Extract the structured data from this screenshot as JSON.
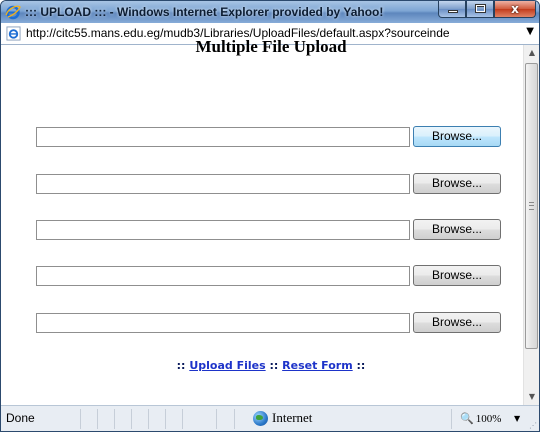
{
  "window": {
    "title": "::: UPLOAD ::: - Windows Internet Explorer provided by Yahoo!",
    "icon": "ie-icon",
    "controls": {
      "minimize": "minimize-icon",
      "maximize": "maximize-icon",
      "close": "x"
    }
  },
  "address": {
    "url": "http://citc55.mans.edu.eg/mudb3/Libraries/UploadFiles/default.aspx?sourceinde",
    "dropdown": "▼"
  },
  "page": {
    "heading": "Multiple File Upload",
    "browse_label": "Browse...",
    "file_rows": [
      {
        "value": "",
        "browse": "Browse..."
      },
      {
        "value": "",
        "browse": "Browse..."
      },
      {
        "value": "",
        "browse": "Browse..."
      },
      {
        "value": "",
        "browse": "Browse..."
      },
      {
        "value": "",
        "browse": "Browse..."
      }
    ],
    "actions": {
      "prefix": "::",
      "upload": "Upload Files",
      "separator": "::",
      "reset": "Reset Form",
      "suffix": "::"
    }
  },
  "scrollbar": {
    "up": "▲",
    "down": "▼"
  },
  "status": {
    "text": "Done",
    "zone": "Internet",
    "zoom": "100%",
    "zoom_icon": "🔍",
    "zoom_drop": "▼"
  },
  "colors": {
    "link": "#1d33c9",
    "title_bar": "#5d86bd"
  }
}
